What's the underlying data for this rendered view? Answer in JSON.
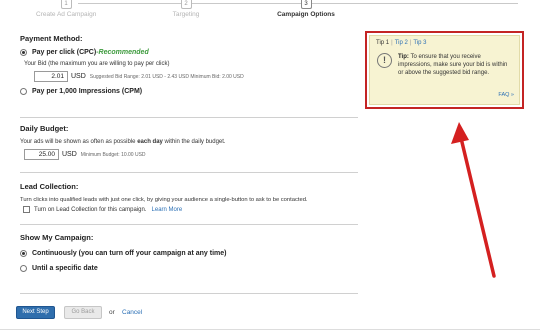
{
  "stepper": {
    "steps": [
      {
        "num": "1",
        "label": "Create Ad Campaign"
      },
      {
        "num": "2",
        "label": "Targeting"
      },
      {
        "num": "3",
        "label": "Campaign Options"
      }
    ]
  },
  "payment": {
    "title": "Payment Method:",
    "cpc_label": "Pay per click (CPC)",
    "cpc_sep": " - ",
    "recommended": "Recommended",
    "bid_hint": "Your Bid (the maximum you are willing to pay per click)",
    "bid_value": "2.01",
    "bid_unit": "USD",
    "bid_note": "Suggested Bid Range: 2.01 USD - 2.43 USD Minimum Bid: 2.00 USD",
    "cpm_label": "Pay per 1,000 Impressions (CPM)"
  },
  "budget": {
    "title": "Daily Budget:",
    "hint_pre": "Your ads will be shown as often as possible ",
    "hint_bold": "each day",
    "hint_post": " within the daily budget.",
    "value": "25.00",
    "unit": "USD",
    "note": "Minimum Budget: 10.00 USD"
  },
  "lead": {
    "title": "Lead Collection:",
    "desc": "Turn clicks into qualified leads with just one click, by giving your audience a single-button to ask to be contacted.",
    "checkbox_label": "Turn on Lead Collection for this campaign.",
    "learn_more": "Learn More"
  },
  "show": {
    "title": "Show My Campaign:",
    "opt_continuous": "Continuously (you can turn off your campaign at any time)",
    "opt_until": "Until a specific date"
  },
  "actions": {
    "next": "Next Step",
    "back": "Go Back",
    "or": "or",
    "cancel": "Cancel"
  },
  "tips": {
    "tab1": "Tip 1",
    "tab2": "Tip 2",
    "tab3": "Tip 3",
    "sep": "|",
    "icon_glyph": "!",
    "tip_label": "Tip:",
    "tip_body": " To ensure that you receive impressions, make sure your bid is within or above the suggested bid range.",
    "faq": "FAQ »"
  },
  "colors": {
    "primary_button": "#2f6ead",
    "recommended": "#3d9a3d",
    "link": "#2a6fb5",
    "annotation_red": "#c42424",
    "tip_background": "#f7f3d2"
  },
  "icons": {
    "tip_icon": "exclamation-circle-icon",
    "annotation": "red-arrow-icon"
  }
}
